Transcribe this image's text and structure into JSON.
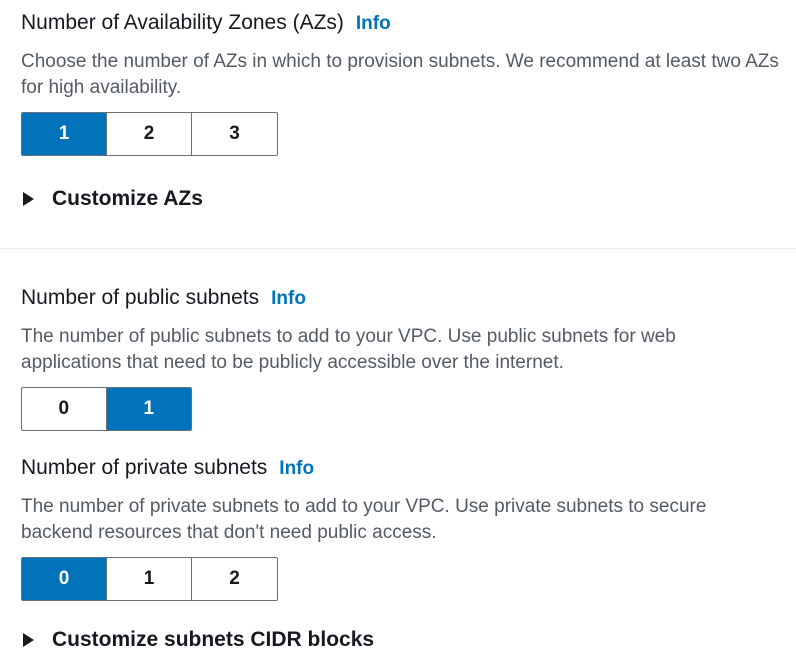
{
  "az": {
    "title": "Number of Availability Zones (AZs)",
    "info": "Info",
    "description": "Choose the number of AZs in which to provision subnets. We recommend at least two AZs for high availability.",
    "options": [
      "1",
      "2",
      "3"
    ],
    "selected": "1",
    "expander": "Customize AZs"
  },
  "public_subnets": {
    "title": "Number of public subnets",
    "info": "Info",
    "description": "The number of public subnets to add to your VPC. Use public subnets for web applications that need to be publicly accessible over the internet.",
    "options": [
      "0",
      "1"
    ],
    "selected": "1"
  },
  "private_subnets": {
    "title": "Number of private subnets",
    "info": "Info",
    "description": "The number of private subnets to add to your VPC. Use private subnets to secure backend resources that don't need public access.",
    "options": [
      "0",
      "1",
      "2"
    ],
    "selected": "0",
    "expander": "Customize subnets CIDR blocks"
  },
  "colors": {
    "accent": "#0073bb",
    "text": "#16191f",
    "secondary_text": "#545b64",
    "border": "#687078"
  },
  "icons": {
    "expander": "caret-right-icon"
  }
}
